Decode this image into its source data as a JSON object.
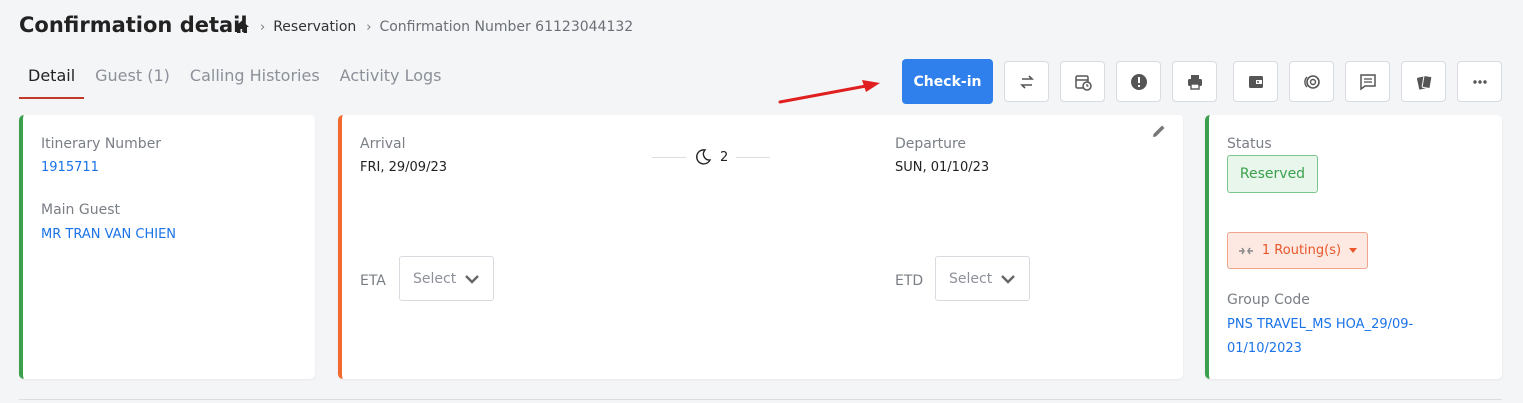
{
  "page": {
    "title": "Confirmation detail"
  },
  "breadcrumb": {
    "home_icon": "home-icon",
    "items": [
      "Reservation",
      "Confirmation Number 61123044132"
    ]
  },
  "tabs": [
    {
      "label": "Detail",
      "active": true
    },
    {
      "label": "Guest (1)",
      "active": false
    },
    {
      "label": "Calling Histories",
      "active": false
    },
    {
      "label": "Activity Logs",
      "active": false
    }
  ],
  "toolbar": {
    "checkin_label": "Check-in",
    "icons": [
      "transfer-icon",
      "calendar-clock-icon",
      "alert-icon",
      "print-icon",
      "wallet-icon",
      "deposit-icon",
      "comment-icon",
      "cards-icon",
      "more-icon"
    ]
  },
  "itinerary": {
    "number_label": "Itinerary Number",
    "number_value": "1915711",
    "guest_label": "Main Guest",
    "guest_value": "MR TRAN VAN CHIEN"
  },
  "stay": {
    "arrival_label": "Arrival",
    "arrival_value": "FRI, 29/09/23",
    "nights": "2",
    "departure_label": "Departure",
    "departure_value": "SUN, 01/10/23",
    "eta_label": "ETA",
    "eta_placeholder": "Select",
    "etd_label": "ETD",
    "etd_placeholder": "Select"
  },
  "status": {
    "label": "Status",
    "value": "Reserved",
    "routing": "1 Routing(s)",
    "group_code_label": "Group Code",
    "group_code_value": "PNS TRAVEL_MS HOA_29/09-01/10/2023"
  },
  "colors": {
    "accent": "#2f80ed",
    "link": "#1a73e8",
    "green": "#3aa04d",
    "orange": "#f26a2e",
    "arrow_red": "#e02020"
  }
}
